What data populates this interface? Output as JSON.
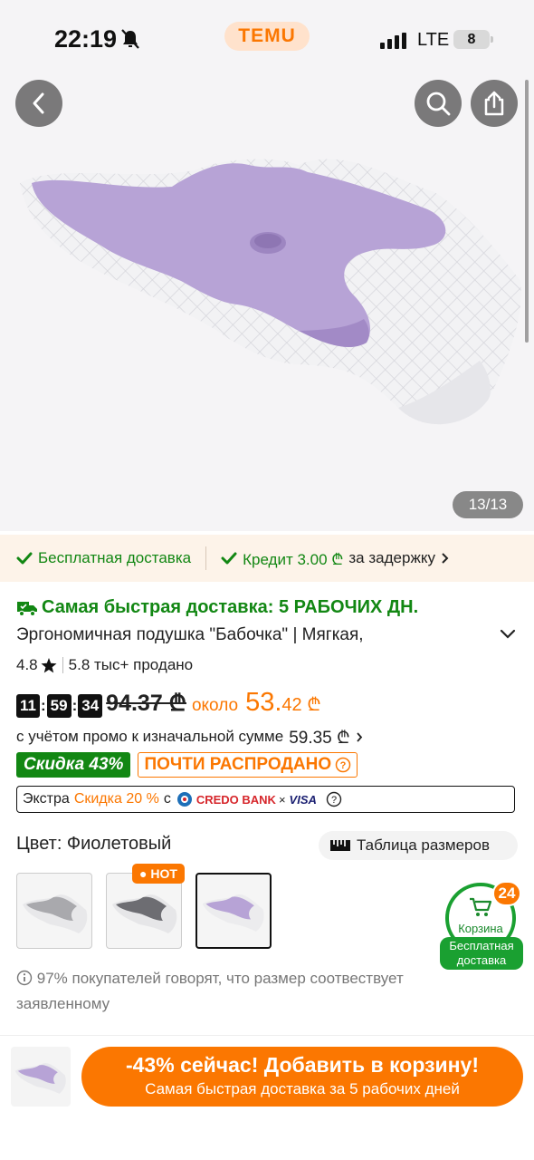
{
  "status": {
    "time": "22:19",
    "app_badge": "TEMU",
    "network": "LTE",
    "battery": "8"
  },
  "gallery": {
    "counter": "13/13"
  },
  "perks": {
    "free_shipping": "Бесплатная доставка",
    "credit": "Кредит 3.00 ₾",
    "credit_suffix": "за задержку"
  },
  "product": {
    "fast_delivery": "Самая быстрая доставка: 5 РАБОЧИХ ДН.",
    "title": "Эргономичная подушка \"Бабочка\" | Мягкая,",
    "rating": "4.8",
    "sold": "5.8 тыс+ продано",
    "timer": {
      "h": "11",
      "m": "59",
      "s": "34"
    },
    "old_price": "94.37 ₾",
    "approx_label": "около",
    "price_main": "53.",
    "price_cents": "42 ₾",
    "promo_text": "с учётом промо к изначальной сумме",
    "promo_price": "59.35 ₾",
    "discount_badge": "Скидка 43%",
    "almost_sold": "ПОЧТИ РАСПРОДАНО",
    "extra_prefix": "Экстра",
    "extra_discount": "Скидка 20 %",
    "extra_with": "с",
    "bank": "CREDO BANK",
    "bank_sep": "×",
    "card": "VISA",
    "color_label": "Цвет: Фиолетовый",
    "size_chart": "Таблица размеров",
    "hot_badge": "HOT",
    "size_note": "97% покупателей говорят, что размер соотвествует заявленному"
  },
  "cart": {
    "count": "24",
    "label": "Корзина",
    "free_shipping": "Бесплатная доставка"
  },
  "cta": {
    "line1": "-43% сейчас! Добавить в корзину!",
    "line2": "Самая быстрая доставка за 5 рабочих дней"
  },
  "colors": {
    "accent": "#fb7701",
    "green": "#128713",
    "pillow_lilac": "#b7a3d6"
  }
}
